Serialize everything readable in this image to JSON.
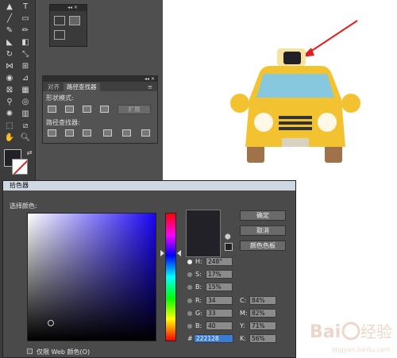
{
  "pathfinder": {
    "tabs": [
      "对齐",
      "路径查找器"
    ],
    "shape_modes_label": "形状模式:",
    "pathfinders_label": "路径查找器:",
    "expand_label": "扩展"
  },
  "color_picker": {
    "title": "拾色器",
    "select_color_label": "选择颜色:",
    "buttons": {
      "ok": "确定",
      "cancel": "取消",
      "swatches": "颜色色板"
    },
    "fields": {
      "H": {
        "label": "H:",
        "value": "248°"
      },
      "S": {
        "label": "S:",
        "value": "17%"
      },
      "B": {
        "label": "B:",
        "value": "15%"
      },
      "R": {
        "label": "R:",
        "value": "34"
      },
      "G": {
        "label": "G:",
        "value": "33"
      },
      "Bl": {
        "label": "B:",
        "value": "40"
      },
      "C": {
        "label": "C:",
        "value": "84%"
      },
      "M": {
        "label": "M:",
        "value": "82%"
      },
      "Y": {
        "label": "Y:",
        "value": "71%"
      },
      "K": {
        "label": "K:",
        "value": "56%"
      },
      "hex_label": "#",
      "hex": "222128"
    },
    "web_only_label": "仅限 Web 颜色(O)",
    "current_color": "#222128"
  },
  "watermark": {
    "text": "Bai经验",
    "url": "jingyan.baidu.com"
  },
  "colors": {
    "taxi_body": "#f2c230",
    "taxi_window": "#87c8de",
    "taxi_sign": "#222128",
    "arrow": "#e02020"
  }
}
